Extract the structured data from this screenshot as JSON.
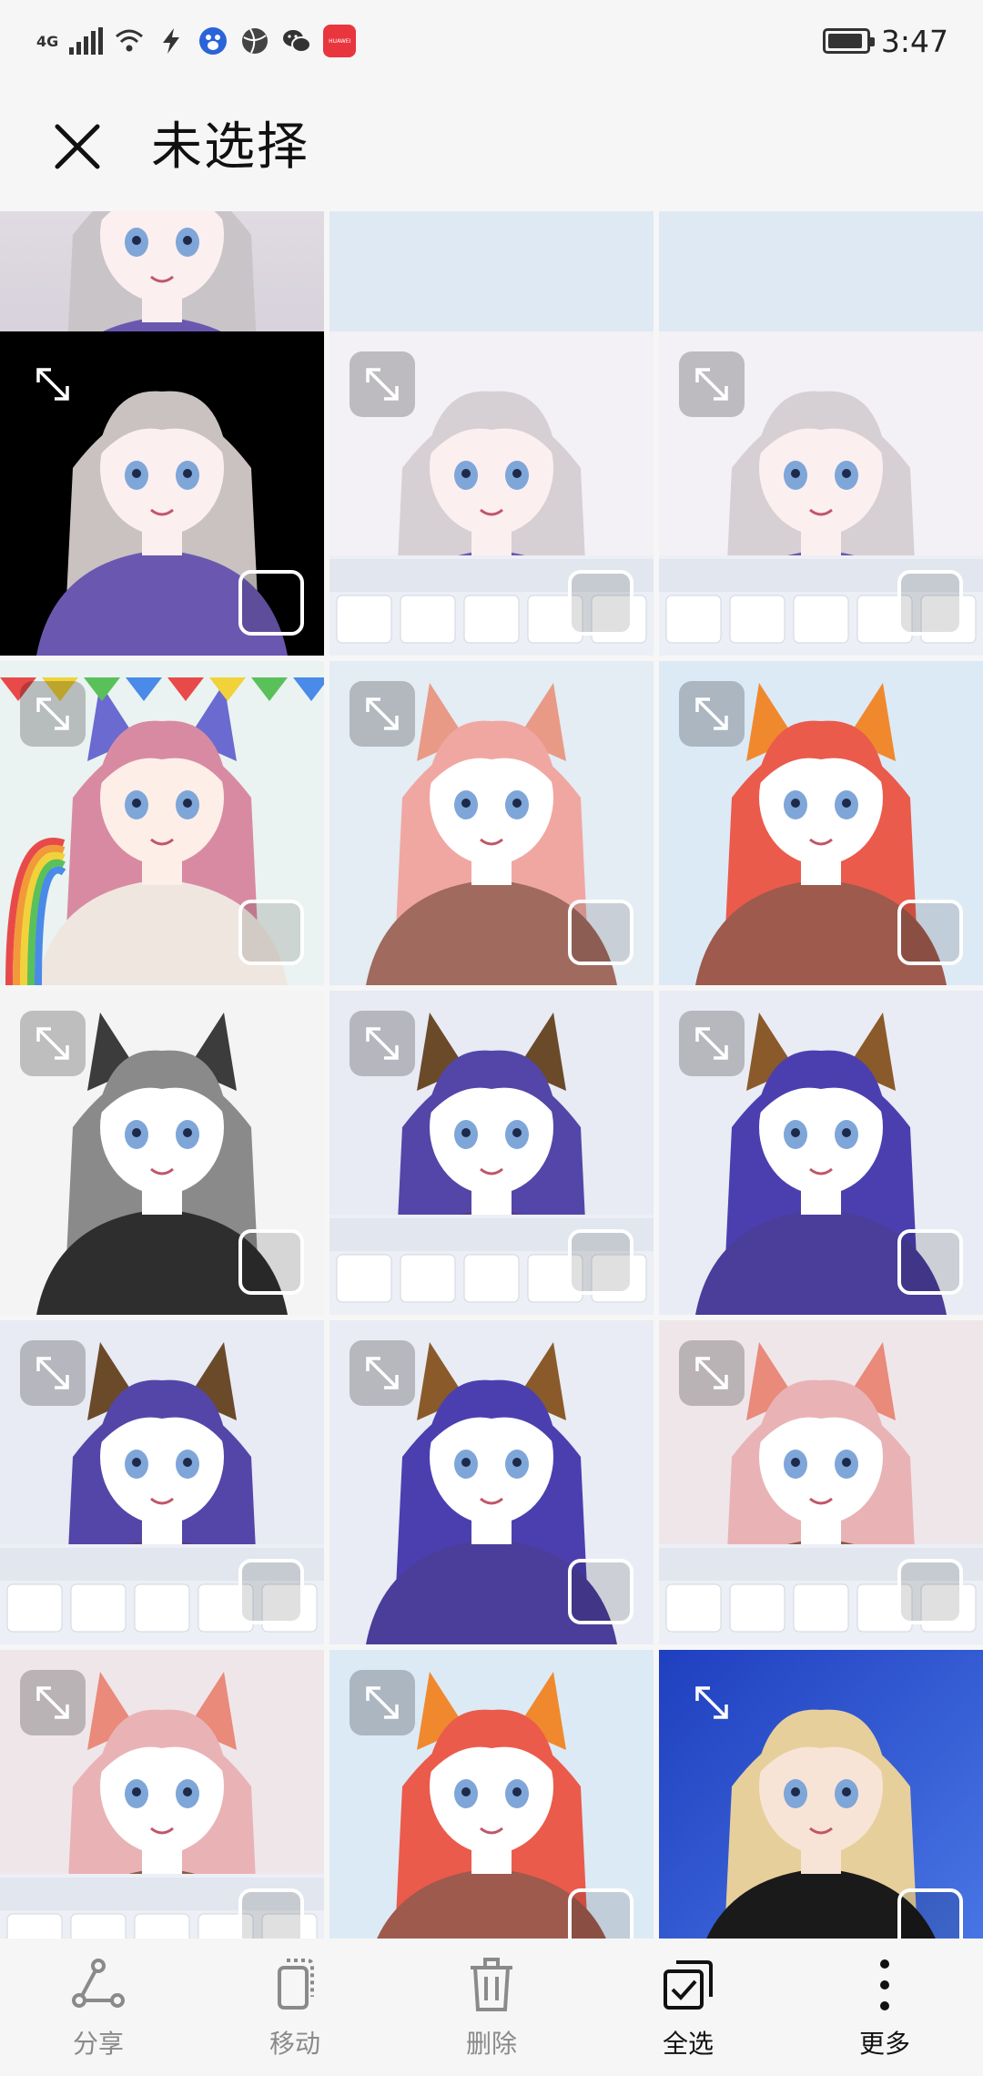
{
  "status_bar": {
    "network": "4G",
    "time": "3:47",
    "battery_level": 0.8,
    "app_icons": [
      "huawei-app-icon"
    ],
    "huawei_label": "HUAWEI"
  },
  "header": {
    "title": "未选择",
    "close_icon": "close-icon"
  },
  "grid": {
    "tiles": [
      {
        "id": "r0c0",
        "theme": "nun-top",
        "selected": false
      },
      {
        "id": "r0c1",
        "theme": "editor-palette",
        "selected": false
      },
      {
        "id": "r0c2",
        "theme": "editor-palette",
        "selected": false
      },
      {
        "id": "r1c0",
        "theme": "nun-black",
        "selected": false
      },
      {
        "id": "r1c1",
        "theme": "nun-editor-sleep",
        "selected": false
      },
      {
        "id": "r1c2",
        "theme": "nun-editor",
        "selected": false
      },
      {
        "id": "r2c0",
        "theme": "rainbow",
        "selected": false
      },
      {
        "id": "r2c1",
        "theme": "fox-pink",
        "selected": false
      },
      {
        "id": "r2c2",
        "theme": "fox-red",
        "selected": false
      },
      {
        "id": "r3c0",
        "theme": "wolf-gray",
        "selected": false
      },
      {
        "id": "r3c1",
        "theme": "bat-editor",
        "selected": false
      },
      {
        "id": "r3c2",
        "theme": "bat-blue",
        "selected": false
      },
      {
        "id": "r4c0",
        "theme": "bat-editor",
        "selected": false
      },
      {
        "id": "r4c1",
        "theme": "bat-blue",
        "selected": false
      },
      {
        "id": "r4c2",
        "theme": "fox-editor",
        "selected": false
      },
      {
        "id": "r5c0",
        "theme": "fox-editor",
        "selected": false
      },
      {
        "id": "r5c1",
        "theme": "fox-red",
        "selected": false
      },
      {
        "id": "r5c2",
        "theme": "blonde-boy",
        "selected": false
      }
    ]
  },
  "toolbar": {
    "share_label": "分享",
    "move_label": "移动",
    "delete_label": "删除",
    "select_all_label": "全选",
    "more_label": "更多"
  },
  "colors": {
    "background": "#f6f6f6",
    "active_label": "#111111",
    "inactive_label": "#8a8a8a"
  }
}
